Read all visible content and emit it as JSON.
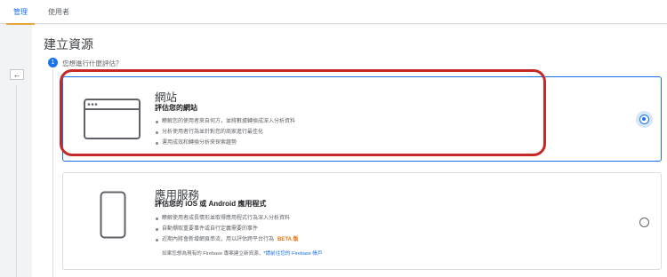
{
  "tabs": [
    {
      "label": "管理",
      "active": true
    },
    {
      "label": "使用者",
      "active": false
    }
  ],
  "back_icon": "←",
  "page_title": "建立資源",
  "step": {
    "number": "1",
    "question": "您想進行什麼評估？"
  },
  "options": [
    {
      "icon": "browser-window-icon",
      "title": "網站",
      "subtitle": "評估您的網站",
      "bullets": [
        "瞭解您的使用者來自何方，並將數據轉換成深入分析資料",
        "分析使用者行為並針對您的商家進行最佳化",
        "運用成效和轉換分析來探索趨勢"
      ],
      "selected": true
    },
    {
      "icon": "mobile-phone-icon",
      "title": "應用服務",
      "subtitle": "評估您的 iOS 或 Android 應用程式",
      "bullets": [
        "瞭解使用者成長情形並取得應用程式行為深入分析資料",
        "自動擷取重要事件或自行定義需要的事件",
        "近期內將會新增網頁串流，用以評估跨平台行為"
      ],
      "beta_label": "BETA 版",
      "firebase_note": "如果您想為現有的 Firebase 專案建立新資源，",
      "firebase_link": "*請前往您的 Firebase 帳戶",
      "selected": false
    }
  ],
  "colors": {
    "accent": "#1a73e8",
    "annotation": "#c62828",
    "beta": "#e8710a"
  }
}
